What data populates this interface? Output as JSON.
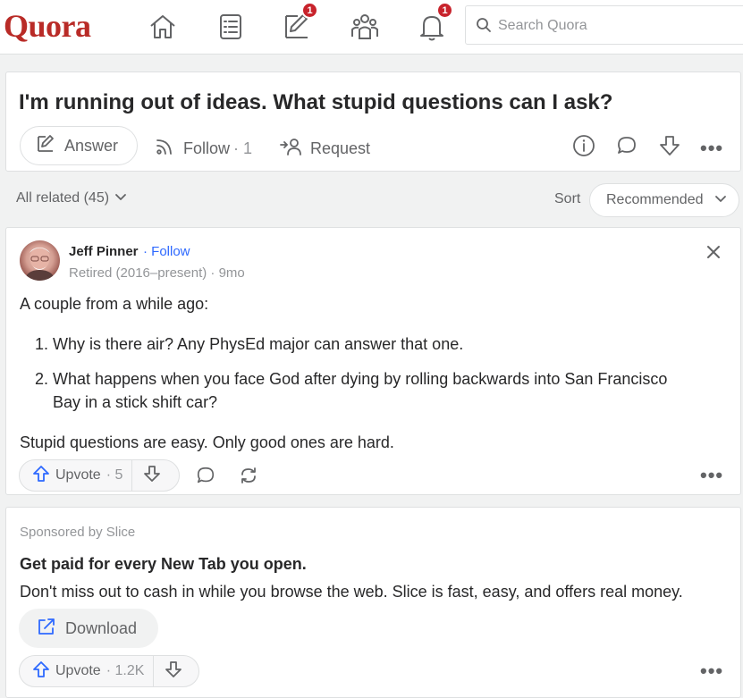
{
  "nav": {
    "logo": "Quora",
    "following_badge": "",
    "answer_badge": "1",
    "notifications_badge": "1",
    "search_placeholder": "Search Quora"
  },
  "question": {
    "title": "I'm running out of ideas. What stupid questions can I ask?",
    "answer_label": "Answer",
    "follow_label": "Follow",
    "follow_count": "· 1",
    "request_label": "Request"
  },
  "filters": {
    "all_related": "All related (45)",
    "sort_label": "Sort",
    "sort_value": "Recommended"
  },
  "answer": {
    "author_name": "Jeff Pinner",
    "follow_link": "· Follow",
    "credential": "Retired (2016–present) · 9mo",
    "intro": "A couple from a while ago:",
    "items": [
      {
        "num": "1.",
        "text": "Why is there air? Any PhysEd major can answer that one."
      },
      {
        "num": "2.",
        "text_line1": "What happens when you face God after dying by rolling backwards into San Francisco",
        "text_line2": "Bay in a stick shift car?"
      }
    ],
    "closing": "Stupid questions are easy. Only good ones are hard.",
    "upvote_label": "Upvote",
    "upvote_count": "· 5",
    "more": "•••"
  },
  "ad": {
    "sponsor": "Sponsored by Slice",
    "headline": "Get paid for every New Tab you open.",
    "body": "Don't miss out to cash in while you browse the web. Slice is fast, easy, and offers real money.",
    "download_label": "Download",
    "upvote_label": "Upvote",
    "upvote_count": "· 1.2K",
    "more": "•••"
  },
  "colors": {
    "brand": "#b92b27",
    "link": "#2e69ff",
    "badge": "#c8232c"
  }
}
